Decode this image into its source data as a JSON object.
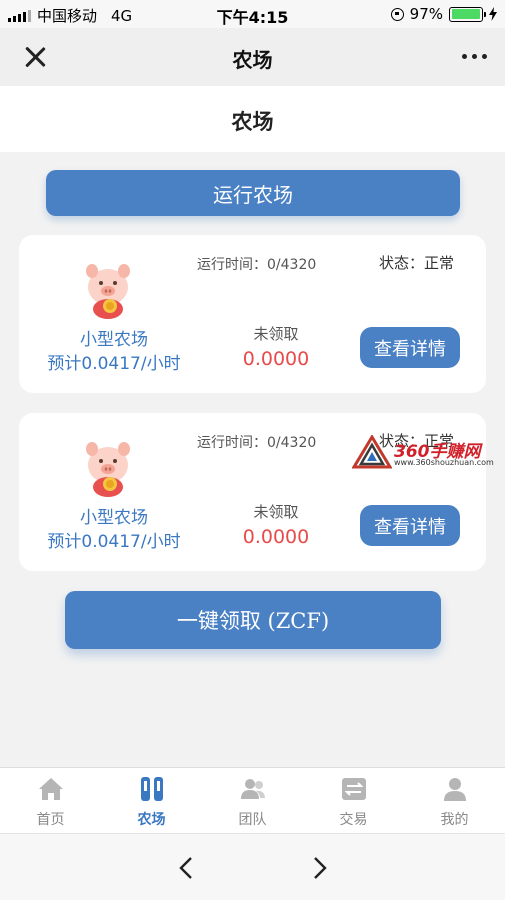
{
  "status_bar": {
    "carrier": "中国移动",
    "network": "4G",
    "time": "下午4:15",
    "battery": "97%",
    "battery_level": 0.97
  },
  "nav": {
    "title": "农场"
  },
  "page": {
    "title": "农场",
    "run_button": "运行农场",
    "claim_all_button": "一键领取 (ZCF)"
  },
  "farms": [
    {
      "name": "小型农场",
      "rate": "预计0.0417/小时",
      "runtime": "运行时间：0/4320",
      "state": "状态：正常",
      "unclaimed_label": "未领取",
      "unclaimed_value": "0.0000",
      "detail_button": "查看详情"
    },
    {
      "name": "小型农场",
      "rate": "预计0.0417/小时",
      "runtime": "运行时间：0/4320",
      "state": "状态：正常",
      "unclaimed_label": "未领取",
      "unclaimed_value": "0.0000",
      "detail_button": "查看详情"
    }
  ],
  "watermark": {
    "brand": "360手赚网",
    "url": "www.360shouzhuan.com"
  },
  "tabs": [
    {
      "label": "首页",
      "icon": "home-icon",
      "active": false
    },
    {
      "label": "农场",
      "icon": "farm-icon",
      "active": true
    },
    {
      "label": "团队",
      "icon": "team-icon",
      "active": false
    },
    {
      "label": "交易",
      "icon": "trade-icon",
      "active": false
    },
    {
      "label": "我的",
      "icon": "profile-icon",
      "active": false
    }
  ],
  "colors": {
    "accent": "#4a80c4",
    "value_red": "#e84b4b",
    "background": "#f2f2f2"
  }
}
